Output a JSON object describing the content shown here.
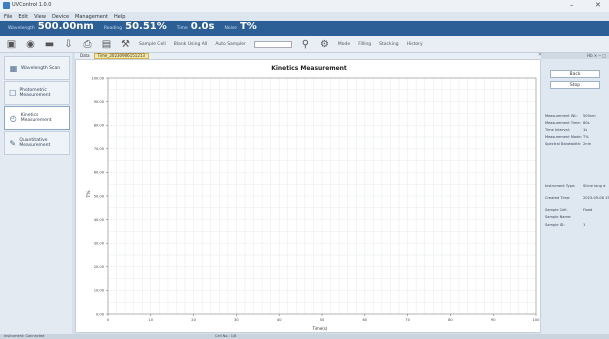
{
  "window": {
    "title": "UVControl 1.0.0",
    "minimize": "–",
    "close": "✕"
  },
  "menu": [
    "File",
    "Edit",
    "View",
    "Device",
    "Management",
    "Help"
  ],
  "status": {
    "wavelength_label": "Wavelength",
    "wavelength_value": "500.00nm",
    "reading_label": "Reading",
    "reading_value": "50.51%",
    "time_label": "Time",
    "time_value": "0.0s",
    "noise_label": "Noise",
    "noise_value": "T%"
  },
  "toolbar": {
    "sample_cell_label": "Sample Cell",
    "blank_item_label": "Blank Using All",
    "auto_sampler_label": "Auto Sampler",
    "mode_label": "Mode",
    "filling_label": "Filling",
    "stacking_label": "Stacking",
    "history_label": "History"
  },
  "nav": [
    {
      "label": "Wavelength Scan",
      "icon": "▦",
      "icon_name": "wavelength-scan-icon"
    },
    {
      "label": "Photometric Measurement",
      "icon": "☐",
      "icon_name": "photometric-icon"
    },
    {
      "label": "Kinetics Measurement",
      "icon": "◴",
      "icon_name": "kinetics-icon"
    },
    {
      "label": "Quantitative Measurement",
      "icon": "✎",
      "icon_name": "quantitative-icon"
    }
  ],
  "tabs": [
    {
      "label": "Data"
    },
    {
      "label": "Time_20230906151213"
    }
  ],
  "right": {
    "header": "Hb  ✕  ─  □",
    "buttons": [
      "Back",
      "Stop"
    ],
    "params": [
      {
        "k": "Measurement WL:",
        "v": "500nm"
      },
      {
        "k": "Measurement Time:",
        "v": "60s"
      },
      {
        "k": "Time Interval:",
        "v": "1s"
      },
      {
        "k": "Measurement Mode:",
        "v": "T%"
      },
      {
        "k": "Spectral Bandwidth:",
        "v": "2nm"
      }
    ],
    "info": [
      {
        "k": "Instrument Type:",
        "v": "Shine long d"
      },
      {
        "k": "Created Time:",
        "v": "2023-09-06 15"
      },
      {
        "k": "Sample Cell:",
        "v": "Fixed"
      },
      {
        "k": "Sample Name:",
        "v": ""
      },
      {
        "k": "Sample ID:",
        "v": "1"
      }
    ]
  },
  "bottom": {
    "left": "Instrument: Connected",
    "mid": "Cell No.: 1/8"
  },
  "chart_data": {
    "type": "line",
    "title": "Kinetics Measurement",
    "xlabel": "Time(s)",
    "ylabel": "T%",
    "xlim": [
      0,
      100
    ],
    "ylim": [
      0,
      100
    ],
    "xticks": [
      0,
      10,
      20,
      30,
      40,
      50,
      60,
      70,
      80,
      90,
      100
    ],
    "yticks": [
      0,
      10,
      20,
      30,
      40,
      50,
      60,
      70,
      80,
      90,
      100
    ],
    "ytick_labels": [
      "0.00",
      "10.00",
      "20.00",
      "30.00",
      "40.00",
      "50.00",
      "60.00",
      "70.00",
      "80.00",
      "90.00",
      "100.00"
    ],
    "grid": true,
    "series": []
  }
}
